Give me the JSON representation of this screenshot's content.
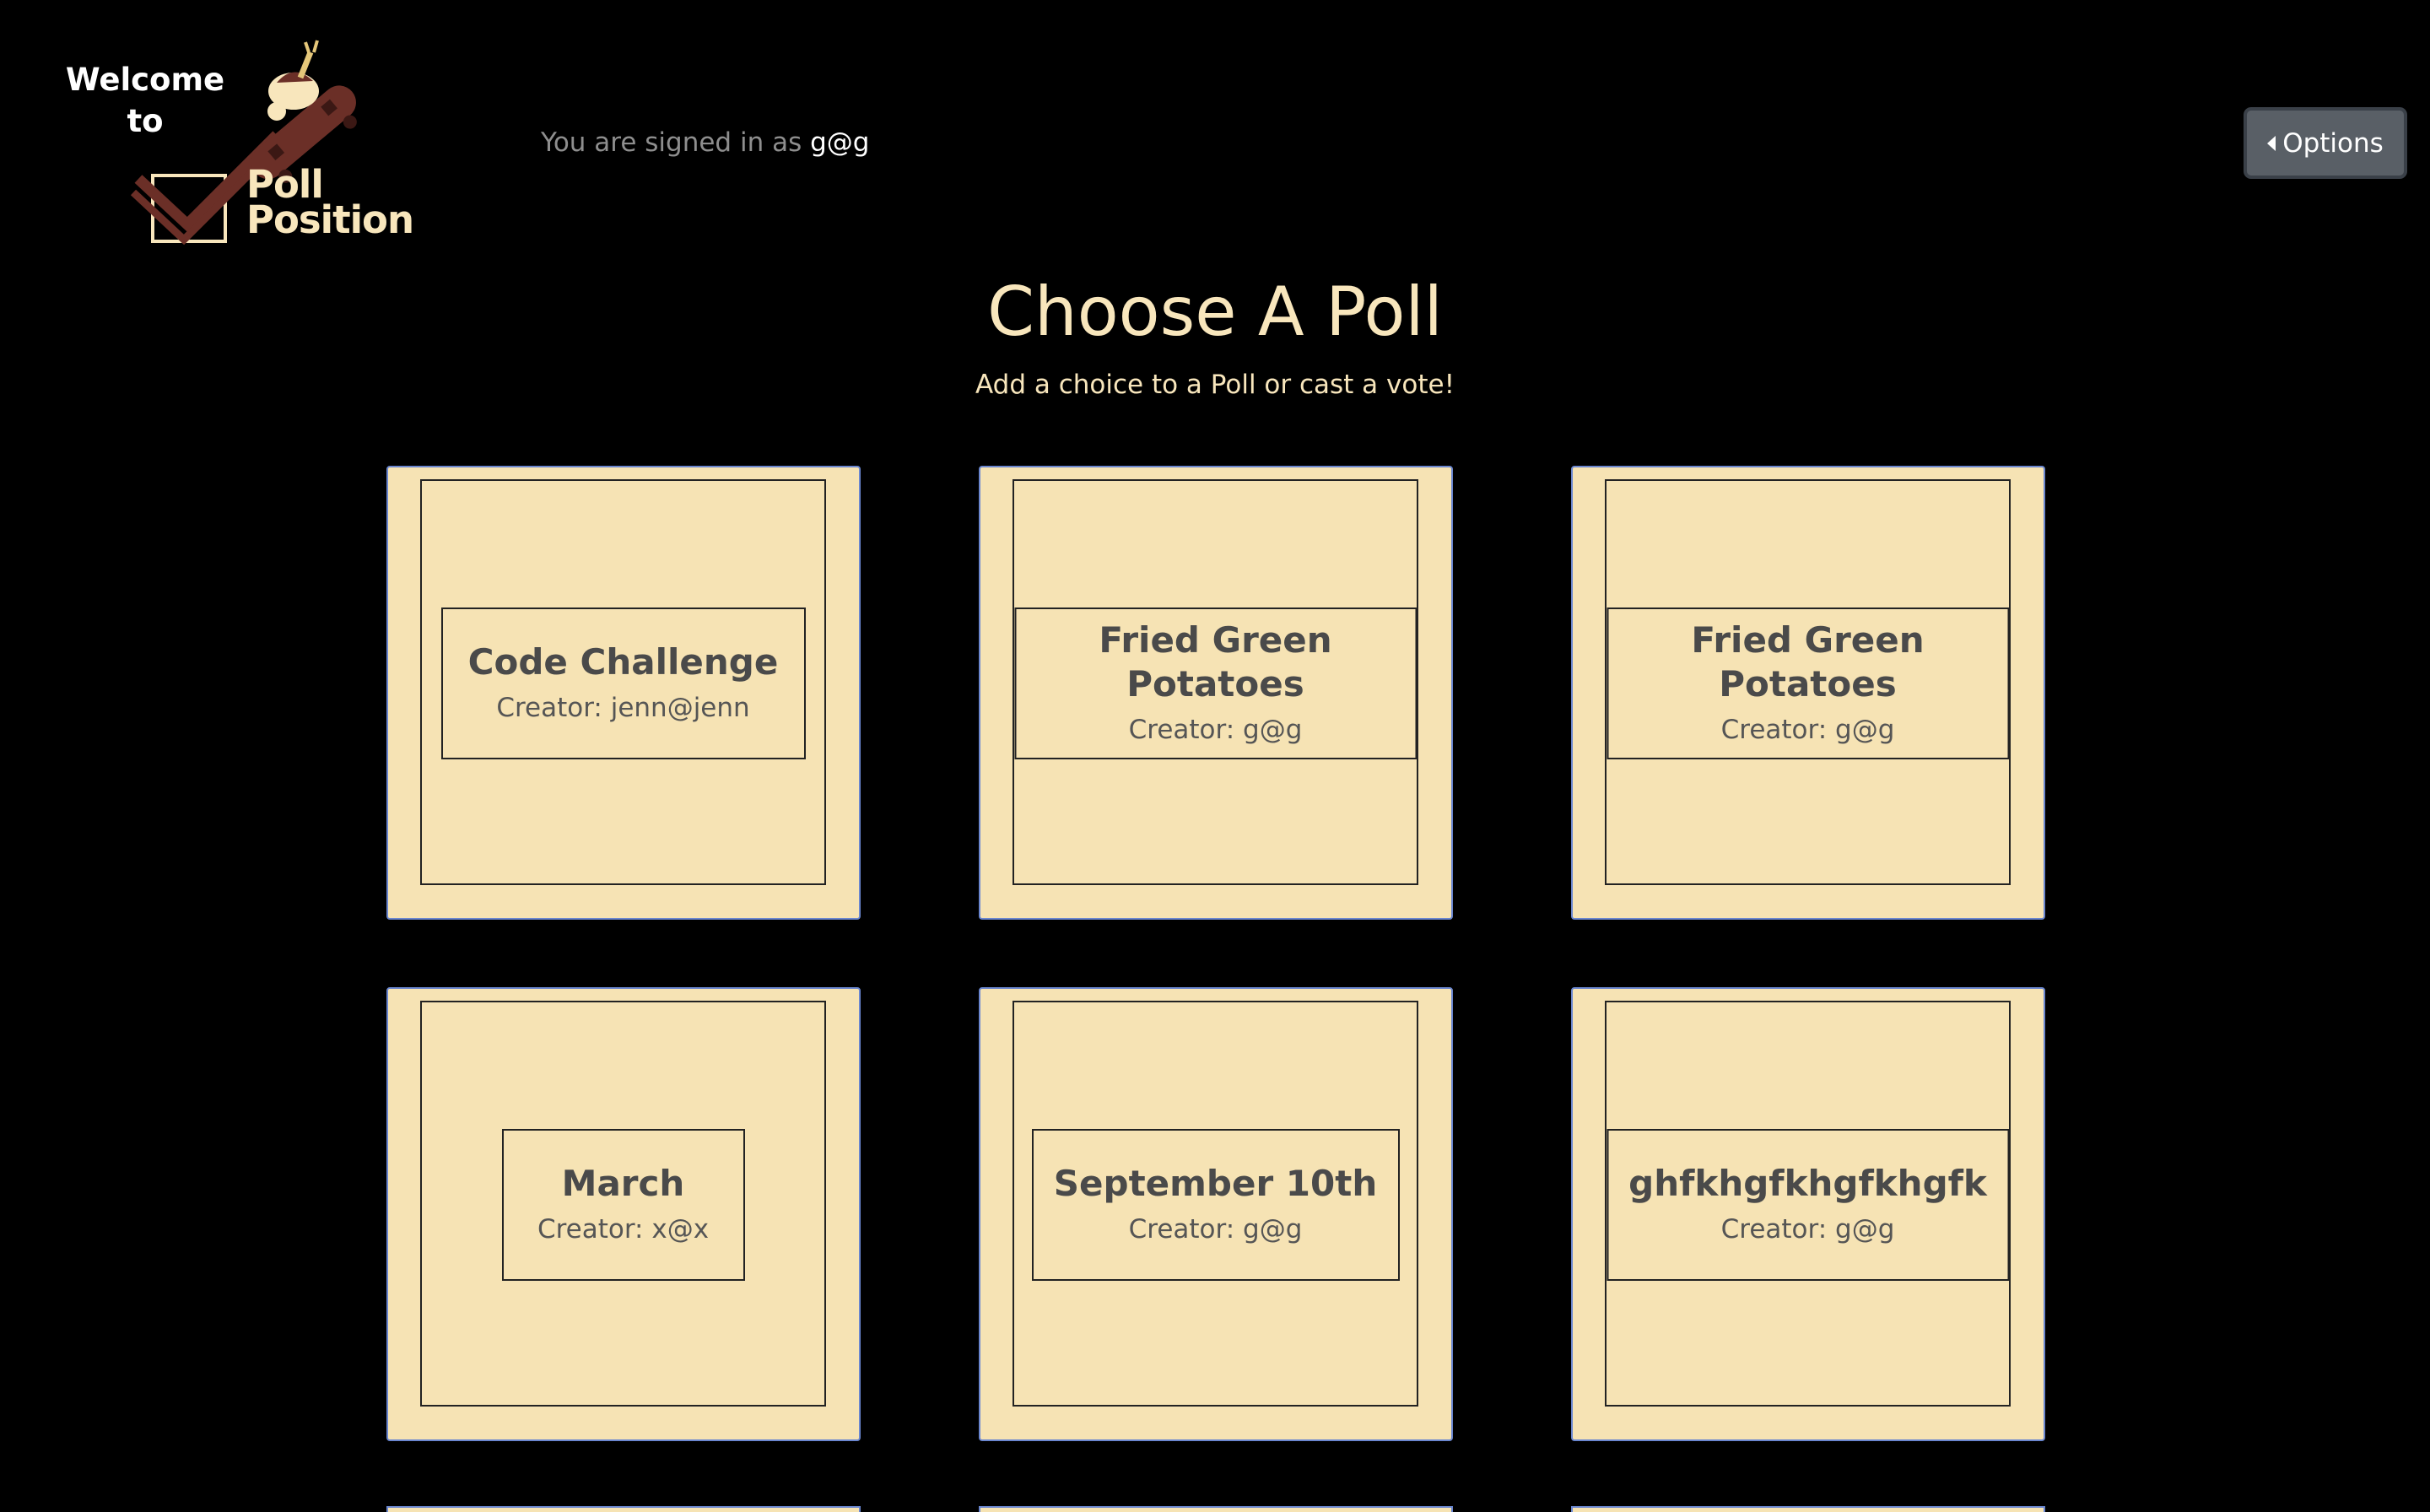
{
  "logo": {
    "welcome_line1": "Welcome",
    "welcome_line2": "to",
    "name_line1": "Poll",
    "name_line2": "Position"
  },
  "header": {
    "signed_in_prefix": "You are signed in as",
    "username": "g@g",
    "options_label": "Options"
  },
  "main": {
    "title": "Choose A Poll",
    "subtitle": "Add a choice to a Poll or cast a vote!"
  },
  "polls": [
    {
      "title": "Code Challenge",
      "creator_prefix": "Creator:",
      "creator": "jenn@jenn"
    },
    {
      "title": "Fried Green Potatoes",
      "creator_prefix": "Creator:",
      "creator": "g@g"
    },
    {
      "title": "Fried Green Potatoes",
      "creator_prefix": "Creator:",
      "creator": "g@g"
    },
    {
      "title": "March",
      "creator_prefix": "Creator:",
      "creator": "x@x"
    },
    {
      "title": "September 10th",
      "creator_prefix": "Creator:",
      "creator": "g@g"
    },
    {
      "title": "ghfkhgfkhgfkhgfk",
      "creator_prefix": "Creator:",
      "creator": "g@g"
    }
  ],
  "colors": {
    "background": "#000000",
    "accent": "#f8e6bc",
    "card": "#f6e3b4",
    "card_border": "#6a86cf",
    "button": "#595f66"
  },
  "icons": {
    "options_caret": "caret-left-icon",
    "logo_art": "skateboard-checkmark-icon"
  }
}
